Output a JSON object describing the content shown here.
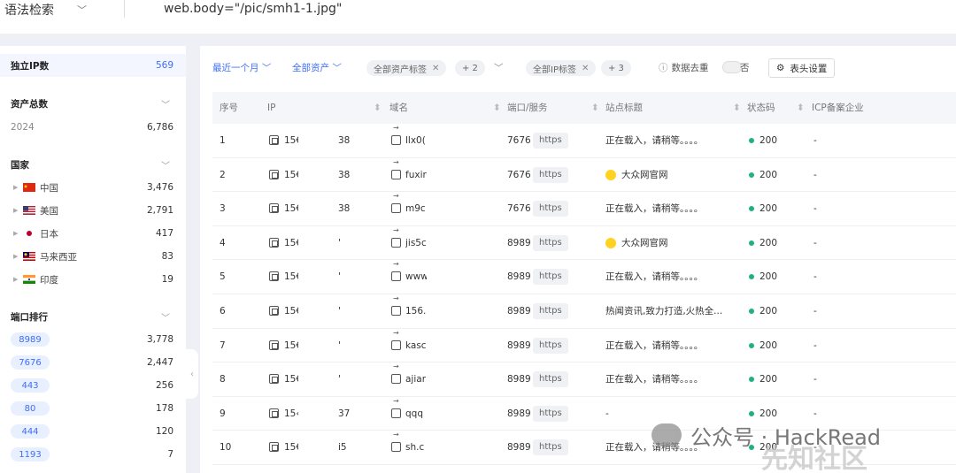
{
  "topbar": {
    "syntax_label": "语法检索",
    "query": "web.body=\"/pic/smh1-1.jpg\""
  },
  "left": {
    "unique_ip": {
      "label": "独立IP数",
      "value": "569"
    },
    "total_assets": {
      "label": "资产总数",
      "year": "2024",
      "year_value": "6,786"
    },
    "countries": {
      "label": "国家",
      "items": [
        {
          "name": "中国",
          "value": "3,476"
        },
        {
          "name": "美国",
          "value": "2,791"
        },
        {
          "name": "日本",
          "value": "417"
        },
        {
          "name": "马来西亚",
          "value": "83"
        },
        {
          "name": "印度",
          "value": "19"
        }
      ]
    },
    "ports": {
      "label": "端口排行",
      "items": [
        {
          "port": "8989",
          "value": "3,778"
        },
        {
          "port": "7676",
          "value": "2,447"
        },
        {
          "port": "443",
          "value": "256"
        },
        {
          "port": "80",
          "value": "178"
        },
        {
          "port": "444",
          "value": "120"
        },
        {
          "port": "1193",
          "value": "7"
        }
      ]
    }
  },
  "filters": {
    "time": "最近一个月",
    "assets": "全部资产",
    "asset_tags": "全部资产标签",
    "asset_tags_more": "+ 2",
    "ip_tags": "全部IP标签",
    "ip_tags_more": "+ 3",
    "dedup_label": "数据去重",
    "dedup_value": "否",
    "header_settings": "表头设置"
  },
  "table": {
    "columns": [
      "序号",
      "IP",
      "域名",
      "端口/服务",
      "站点标题",
      "状态码",
      "ICP备案企业"
    ],
    "rows": [
      {
        "n": "1",
        "ip": "15€",
        "ip_tail": "38",
        "domain": "llx0(",
        "port": "7676",
        "proto": "https",
        "title": "正在载入，请稍等。。。。",
        "icon": false,
        "status": "200",
        "icp": "-"
      },
      {
        "n": "2",
        "ip": "15€",
        "ip_tail": "38",
        "domain": "fuxir",
        "port": "7676",
        "proto": "https",
        "title": "大众网官网",
        "icon": true,
        "status": "200",
        "icp": "-"
      },
      {
        "n": "3",
        "ip": "15€",
        "ip_tail": "38",
        "domain": "m9c",
        "port": "7676",
        "proto": "https",
        "title": "正在载入，请稍等。。。。",
        "icon": false,
        "status": "200",
        "icp": "-"
      },
      {
        "n": "4",
        "ip": "15€",
        "ip_tail": "'",
        "domain": "jis5c",
        "port": "8989",
        "proto": "https",
        "title": "大众网官网",
        "icon": true,
        "status": "200",
        "icp": "-"
      },
      {
        "n": "5",
        "ip": "15€",
        "ip_tail": "'",
        "domain": "www",
        "port": "8989",
        "proto": "https",
        "title": "正在载入，请稍等。。。。",
        "icon": false,
        "status": "200",
        "icp": "-"
      },
      {
        "n": "6",
        "ip": "15€",
        "ip_tail": "'",
        "domain": "156.",
        "port": "8989",
        "proto": "https",
        "title": "热闻资讯,致力打造,火热全...",
        "icon": false,
        "status": "200",
        "icp": "-"
      },
      {
        "n": "7",
        "ip": "15€",
        "ip_tail": "'",
        "domain": "kasc",
        "port": "8989",
        "proto": "https",
        "title": "正在载入，请稍等。。。。",
        "icon": false,
        "status": "200",
        "icp": "-"
      },
      {
        "n": "8",
        "ip": "15€",
        "ip_tail": "'",
        "domain": "ajiar",
        "port": "8989",
        "proto": "https",
        "title": "正在载入，请稍等。。。。",
        "icon": false,
        "status": "200",
        "icp": "-"
      },
      {
        "n": "9",
        "ip": "15‹",
        "ip_tail": "37",
        "domain": "qqq",
        "port": "8989",
        "proto": "https",
        "title": "-",
        "icon": false,
        "status": "200",
        "icp": "-"
      },
      {
        "n": "10",
        "ip": "15€",
        "ip_tail": "i5",
        "domain": "sh.c",
        "port": "8989",
        "proto": "https",
        "title": "正在载入，请稍等。。。。",
        "icon": false,
        "status": "200",
        "icp": "-"
      }
    ]
  },
  "watermark": {
    "text": "公众号 · HackRead",
    "text2": "先知社区"
  }
}
